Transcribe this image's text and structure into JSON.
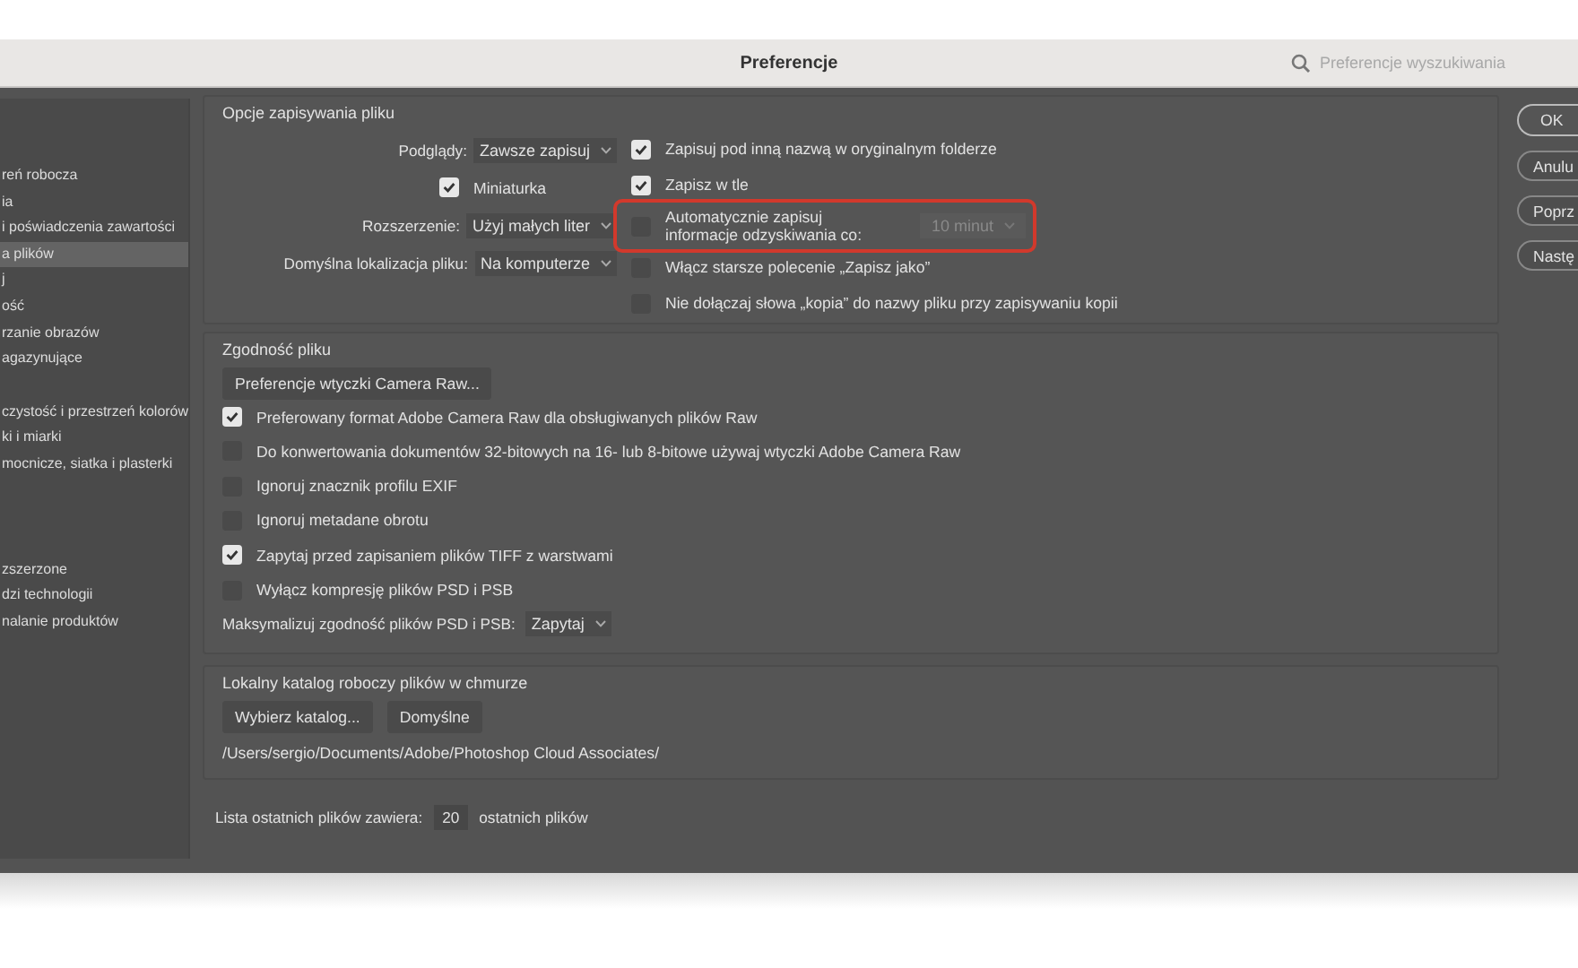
{
  "window": {
    "title": "Preferencje"
  },
  "search": {
    "placeholder": "Preferencje wyszukiwania"
  },
  "sidebar": {
    "groups": [
      [
        {
          "label": "reń robocza",
          "selected": false
        },
        {
          "label": "ia",
          "selected": false
        },
        {
          "label": "i poświadczenia zawartości",
          "selected": false
        },
        {
          "label": "a plików",
          "selected": true
        },
        {
          "label": "j",
          "selected": false
        },
        {
          "label": "ość",
          "selected": false
        },
        {
          "label": "rzanie obrazów",
          "selected": false
        },
        {
          "label": "agazynujące",
          "selected": false
        }
      ],
      [
        {
          "label": "czystość i przestrzeń kolorów",
          "selected": false
        },
        {
          "label": "ki i miarki",
          "selected": false
        },
        {
          "label": "mocnicze, siatka i plasterki",
          "selected": false
        }
      ],
      [
        {
          "label": "zszerzone",
          "selected": false
        },
        {
          "label": "dzi technologii",
          "selected": false
        },
        {
          "label": "nalanie produktów",
          "selected": false
        }
      ]
    ]
  },
  "file_saving": {
    "title": "Opcje zapisywania pliku",
    "previews": {
      "label": "Podglądy:",
      "value": "Zawsze zapisuj"
    },
    "thumbnail": {
      "label": "Miniaturka",
      "checked": true
    },
    "extension": {
      "label": "Rozszerzenie:",
      "value": "Użyj małych liter"
    },
    "default_location": {
      "label": "Domyślna lokalizacja pliku:",
      "value": "Na komputerze"
    },
    "options": [
      {
        "label": "Zapisuj pod inną nazwą w oryginalnym folderze",
        "checked": true,
        "highlighted": false
      },
      {
        "label": "Zapisz w tle",
        "checked": true,
        "highlighted": false
      },
      {
        "label": "Automatycznie zapisuj informacje odzyskiwania co:",
        "checked": false,
        "highlighted": true,
        "interval": {
          "value": "10 minut",
          "disabled": true
        }
      },
      {
        "label": "Włącz starsze polecenie „Zapisz jako”",
        "checked": false,
        "highlighted": false
      },
      {
        "label": "Nie dołączaj słowa „kopia” do nazwy pliku przy zapisywaniu kopii",
        "checked": false,
        "highlighted": false
      }
    ]
  },
  "compatibility": {
    "title": "Zgodność pliku",
    "button": "Preferencje wtyczki Camera Raw...",
    "options": [
      {
        "label": "Preferowany format Adobe Camera Raw dla obsługiwanych plików Raw",
        "checked": true
      },
      {
        "label": "Do konwertowania dokumentów 32-bitowych na 16- lub 8-bitowe używaj wtyczki Adobe Camera Raw",
        "checked": false
      },
      {
        "label": "Ignoruj znacznik profilu EXIF",
        "checked": false
      },
      {
        "label": "Ignoruj metadane obrotu",
        "checked": false
      },
      {
        "label": "Zapytaj przed zapisaniem plików TIFF z warstwami",
        "checked": true
      },
      {
        "label": "Wyłącz kompresję plików PSD i PSB",
        "checked": false
      }
    ],
    "maximize": {
      "label": "Maksymalizuj zgodność plików PSD i PSB:",
      "value": "Zapytaj"
    }
  },
  "cloud": {
    "title": "Lokalny katalog roboczy plików w chmurze",
    "buttons": [
      "Wybierz katalog...",
      "Domyślne"
    ],
    "path": "/Users/sergio/Documents/Adobe/Photoshop Cloud Associates/"
  },
  "recent": {
    "label": "Lista ostatnich plików zawiera:",
    "value": "20",
    "suffix": "ostatnich plików"
  },
  "buttons": [
    {
      "label": "OK",
      "default": true
    },
    {
      "label": "Anulu",
      "default": false
    },
    {
      "label": "Poprz",
      "default": false
    },
    {
      "label": "Nastę",
      "default": false
    }
  ]
}
